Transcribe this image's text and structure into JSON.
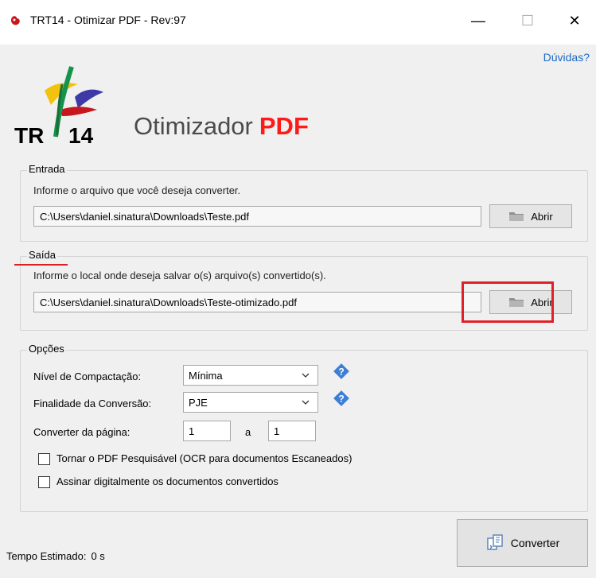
{
  "window": {
    "title": "TRT14 - Otimizar PDF - Rev:97",
    "minimize_glyph": "—",
    "maximize_glyph": "☐",
    "close_glyph": "✕"
  },
  "header": {
    "help_link": "Dúvidas?",
    "logo_text": "TR",
    "logo_number": "14",
    "app_name": "Otimizador",
    "app_name_accent": "PDF"
  },
  "input_group": {
    "label": "Entrada",
    "description": "Informe o arquivo que você deseja converter.",
    "path_value": "C:\\Users\\daniel.sinatura\\Downloads\\Teste.pdf",
    "open_label": "Abrir",
    "open_icon": "folder-icon"
  },
  "output_group": {
    "label": "Saída",
    "description": "Informe o local onde deseja salvar o(s) arquivo(s) convertido(s).",
    "path_value": "C:\\Users\\daniel.sinatura\\Downloads\\Teste-otimizado.pdf",
    "open_label": "Abrir",
    "open_icon": "folder-icon"
  },
  "options_group": {
    "label": "Opções",
    "compression_label": "Nível de Compactação:",
    "compression_value": "Mínima",
    "purpose_label": "Finalidade da Conversão:",
    "purpose_value": "PJE",
    "page_range_label": "Converter da página:",
    "page_from": "1",
    "page_to_label": "a",
    "page_to": "1",
    "ocr_label": "Tornar o PDF Pesquisável (OCR para documentos Escaneados)",
    "ocr_checked": false,
    "sign_label": "Assinar digitalmente os documentos convertidos",
    "sign_checked": false
  },
  "footer": {
    "estimate_label": "Tempo Estimado:",
    "estimate_value": "0 s",
    "convert_label": "Converter",
    "convert_icon": "convert-icon"
  },
  "colors": {
    "accent_red": "#ff1a1a",
    "highlight_red": "#e0202a",
    "link_blue": "#1d68c8",
    "help_icon_blue": "#3d7fd6"
  }
}
